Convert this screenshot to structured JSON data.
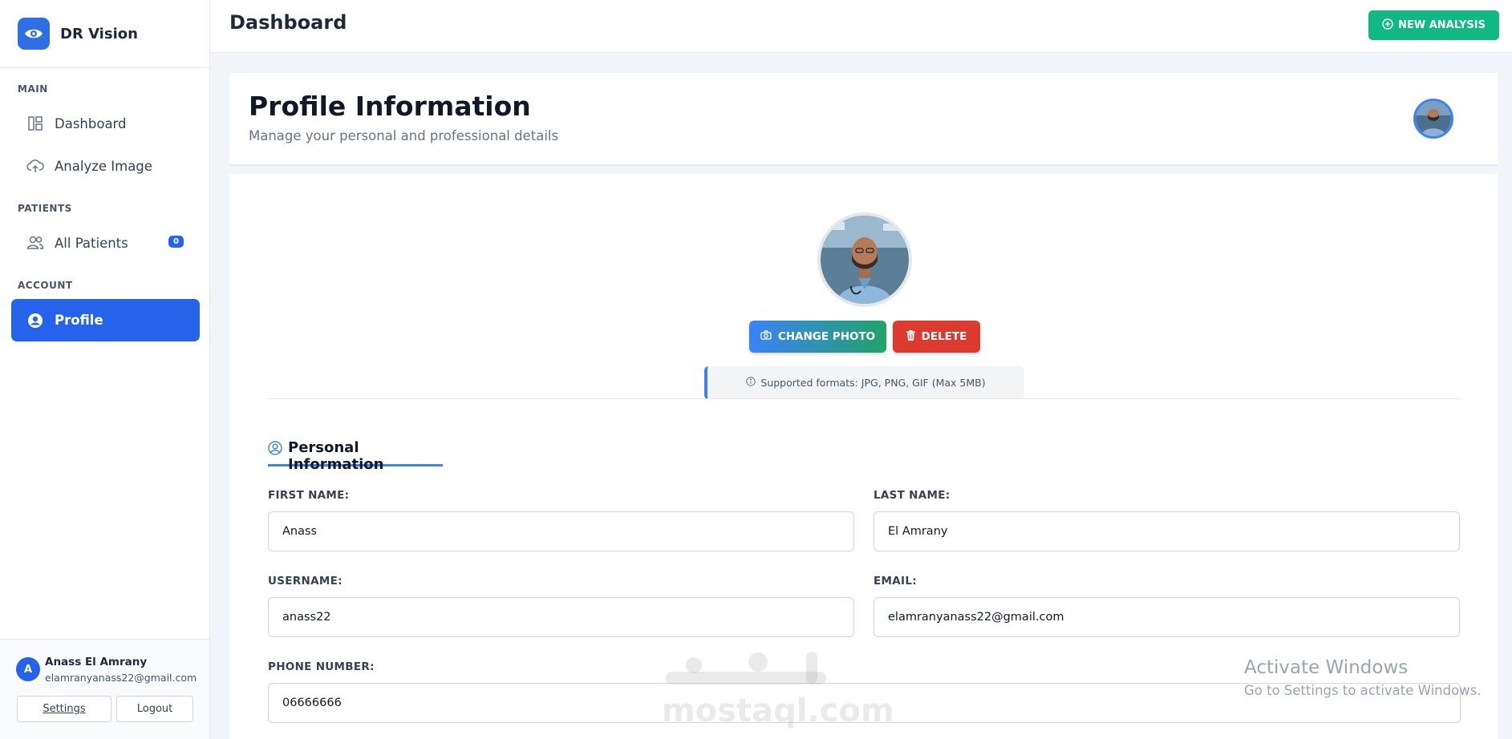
{
  "brand": {
    "name": "DR Vision",
    "icon": "eye-icon",
    "color": "#2f6fe6"
  },
  "sidebar": {
    "sections": [
      "MAIN",
      "PATIENTS",
      "ACCOUNT"
    ],
    "items": [
      {
        "label": "Dashboard",
        "icon": "dashboard-icon"
      },
      {
        "label": "Analyze Image",
        "icon": "cloud-upload-icon"
      },
      {
        "label": "All Patients",
        "icon": "users-icon",
        "badge": "0"
      },
      {
        "label": "Profile",
        "icon": "user-circle-icon",
        "active": true
      }
    ],
    "user": {
      "initial": "A",
      "name": "Anass El Amrany",
      "email": "elamranyanass22@gmail.com"
    },
    "settings_label": "Settings",
    "logout_label": "Logout"
  },
  "header": {
    "title": "Dashboard",
    "new_analysis_label": "NEW ANALYSIS",
    "new_analysis_color": "#10b981"
  },
  "profile_head": {
    "title": "Profile Information",
    "subtitle": "Manage your personal and professional details"
  },
  "photo": {
    "change_label": "CHANGE PHOTO",
    "delete_label": "DELETE",
    "formats_note": "Supported formats: JPG, PNG, GIF (Max 5MB)"
  },
  "personal": {
    "section_title": "Personal Information",
    "first_name_label": "FIRST NAME:",
    "first_name": "Anass",
    "last_name_label": "LAST NAME:",
    "last_name": "El Amrany",
    "username_label": "USERNAME:",
    "username": "anass22",
    "email_label": "EMAIL:",
    "email": "elamranyanass22@gmail.com",
    "phone_label": "PHONE NUMBER:",
    "phone": "06666666"
  },
  "watermark": "mostaql.com",
  "os_notice": {
    "line1": "Activate Windows",
    "line2": "Go to Settings to activate Windows."
  }
}
